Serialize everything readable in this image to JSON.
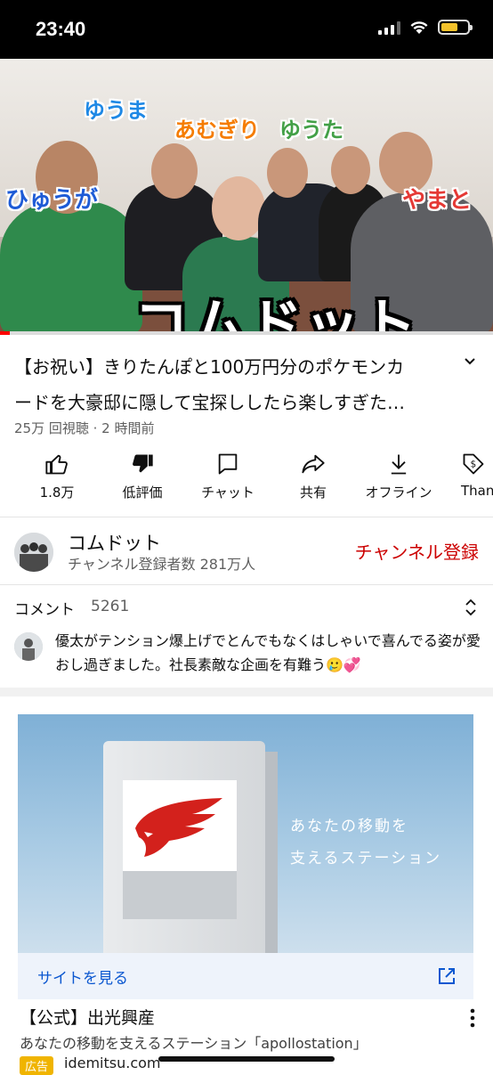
{
  "status_bar": {
    "time": "23:40"
  },
  "video": {
    "overlay_names": [
      "ゆうま",
      "あむぎり",
      "ゆうた",
      "ひゅうが",
      "やまと"
    ],
    "overlay_title": "コムドット",
    "progress": 0.02
  },
  "video_info": {
    "title": "【お祝い】きりたんぽと100万円分のポケモンカードを大豪邸に隠して宝探ししたら楽しすぎた…",
    "title_line1": "【お祝い】きりたんぽと100万円分のポケモンカ",
    "title_line2": "ードを大豪邸に隠して宝探ししたら楽しすぎた…",
    "meta": "25万 回視聴 · 2 時間前"
  },
  "actions": [
    {
      "label": "1.8万",
      "icon": "thumbs-up-icon"
    },
    {
      "label": "低評価",
      "icon": "thumbs-down-icon"
    },
    {
      "label": "チャット",
      "icon": "chat-icon"
    },
    {
      "label": "共有",
      "icon": "share-icon"
    },
    {
      "label": "オフライン",
      "icon": "download-icon"
    },
    {
      "label": "Than",
      "icon": "thanks-icon"
    }
  ],
  "channel": {
    "name": "コムドット",
    "subscribers": "チャンネル登録者数 281万人",
    "subscribe_label": "チャンネル登録"
  },
  "comments": {
    "header": "コメント",
    "count": "5261",
    "top_comment": "優太がテンション爆上げでとんでもなくはしゃいで喜んでる姿が愛おし過ぎました。社長素敵な企画を有難う🥲💞"
  },
  "ad": {
    "image_copy_line1": "あなたの移動を",
    "image_copy_line2": "支えるステーション",
    "cta": "サイトを見る",
    "title": "【公式】出光興産",
    "description": "あなたの移動を支えるステーション「apollostation」",
    "badge": "広告",
    "domain": "idemitsu.com"
  },
  "colors": {
    "subscribe": "#cc0000",
    "progress": "#ff0000",
    "ad_link": "#0b57d0",
    "ad_badge": "#f0b400"
  }
}
